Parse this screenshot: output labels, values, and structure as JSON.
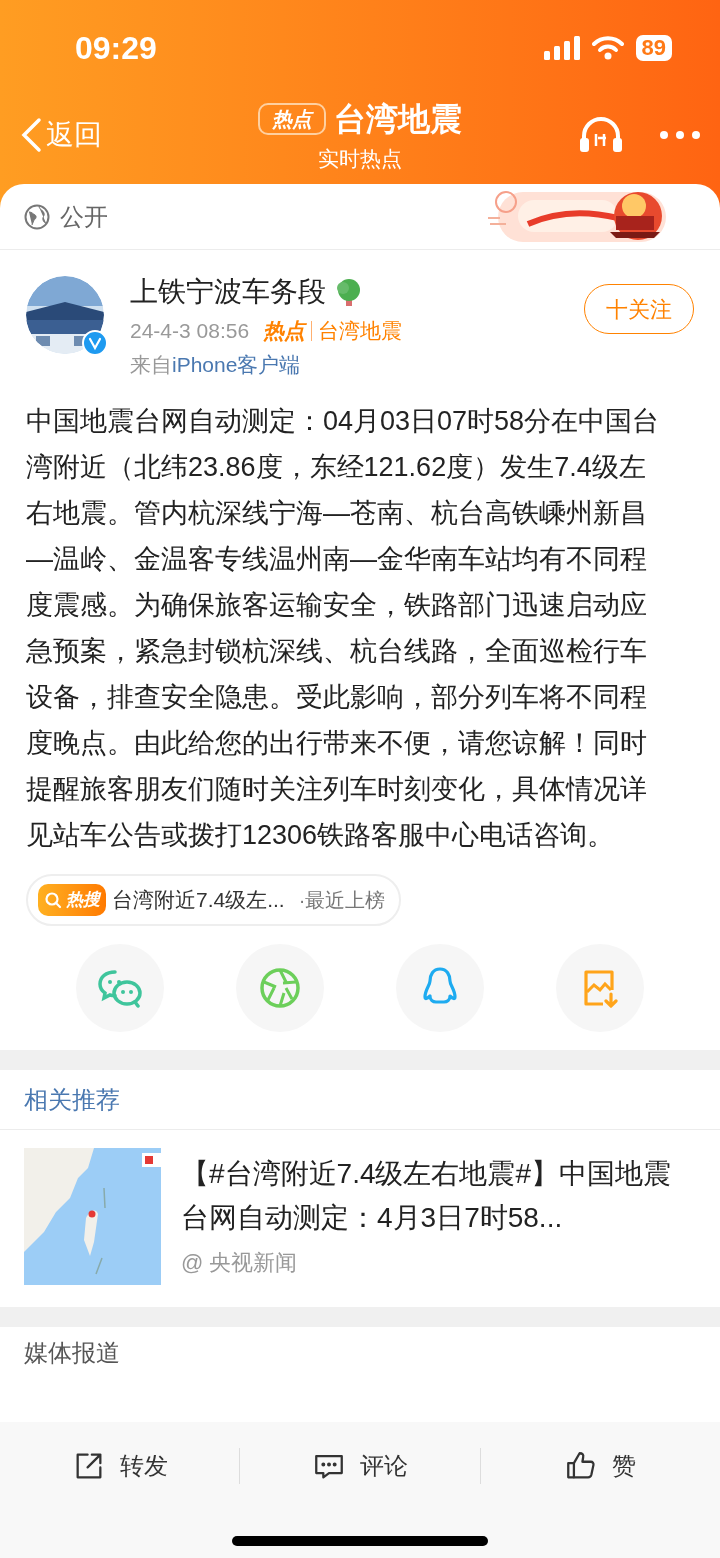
{
  "status_bar": {
    "time": "09:29",
    "battery": "89"
  },
  "nav": {
    "back_label": "返回",
    "hot_tag": "热点",
    "title": "台湾地震",
    "subtitle": "实时热点"
  },
  "visibility": {
    "label": "公开"
  },
  "post": {
    "author": "上铁宁波车务段",
    "date": "24-4-3 08:56",
    "hot_tag": "热点",
    "topic": "台湾地震",
    "source_prefix": "来自",
    "source_client": "iPhone客户端",
    "follow_label": "十关注",
    "verified": true,
    "body": "中国地震台网自动测定：04月03日07时58分在中国台湾附近（北纬23.86度，东经121.62度）发生7.4级左右地震。管内杭深线宁海—苍南、杭台高铁嵊州新昌—温岭、金温客专线温州南—金华南车站均有不同程度震感。为确保旅客运输安全，铁路部门迅速启动应急预案，紧急封锁杭深线、杭台线路，全面巡检行车设备，排查安全隐患。受此影响，部分列车将不同程度晚点。由此给您的出行带来不便，请您谅解！同时提醒旅客朋友们随时关注列车时刻变化，具体情况详见站车公告或拨打12306铁路客服中心电话咨询。",
    "hot_search": {
      "tag": "热搜",
      "title": "台湾附近7.4级左...",
      "suffix": "·最近上榜"
    }
  },
  "related": {
    "heading": "相关推荐",
    "items": [
      {
        "title": "【#台湾附近7.4级左右地震#】中国地震台网自动测定：4月3日7时58...",
        "source": "@ 央视新闻"
      }
    ]
  },
  "media": {
    "heading": "媒体报道"
  },
  "actions": [
    {
      "kind": "repost",
      "label": "转发"
    },
    {
      "kind": "comment",
      "label": "评论"
    },
    {
      "kind": "like",
      "label": "赞"
    }
  ]
}
